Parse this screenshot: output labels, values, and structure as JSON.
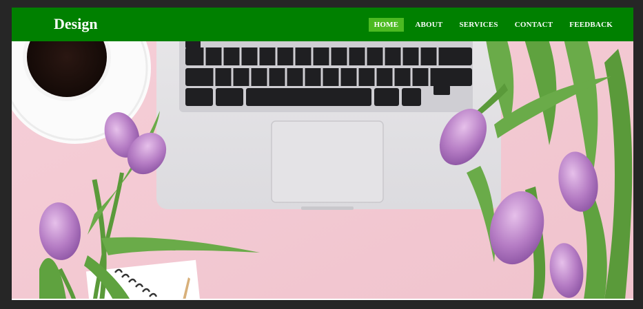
{
  "brand": {
    "name": "Design"
  },
  "nav": {
    "items": [
      {
        "label": "HOME",
        "active": true
      },
      {
        "label": "ABOUT",
        "active": false
      },
      {
        "label": "SERVICES",
        "active": false
      },
      {
        "label": "CONTACT",
        "active": false
      },
      {
        "label": "FEEDBACK",
        "active": false
      }
    ]
  },
  "colors": {
    "navbar": "#008000",
    "active_nav": "#4cba22",
    "page_background": "#262626",
    "hero_background": "#f3c9d3"
  },
  "hero": {
    "image": "laptop-tulips-coffee-flatlay"
  }
}
